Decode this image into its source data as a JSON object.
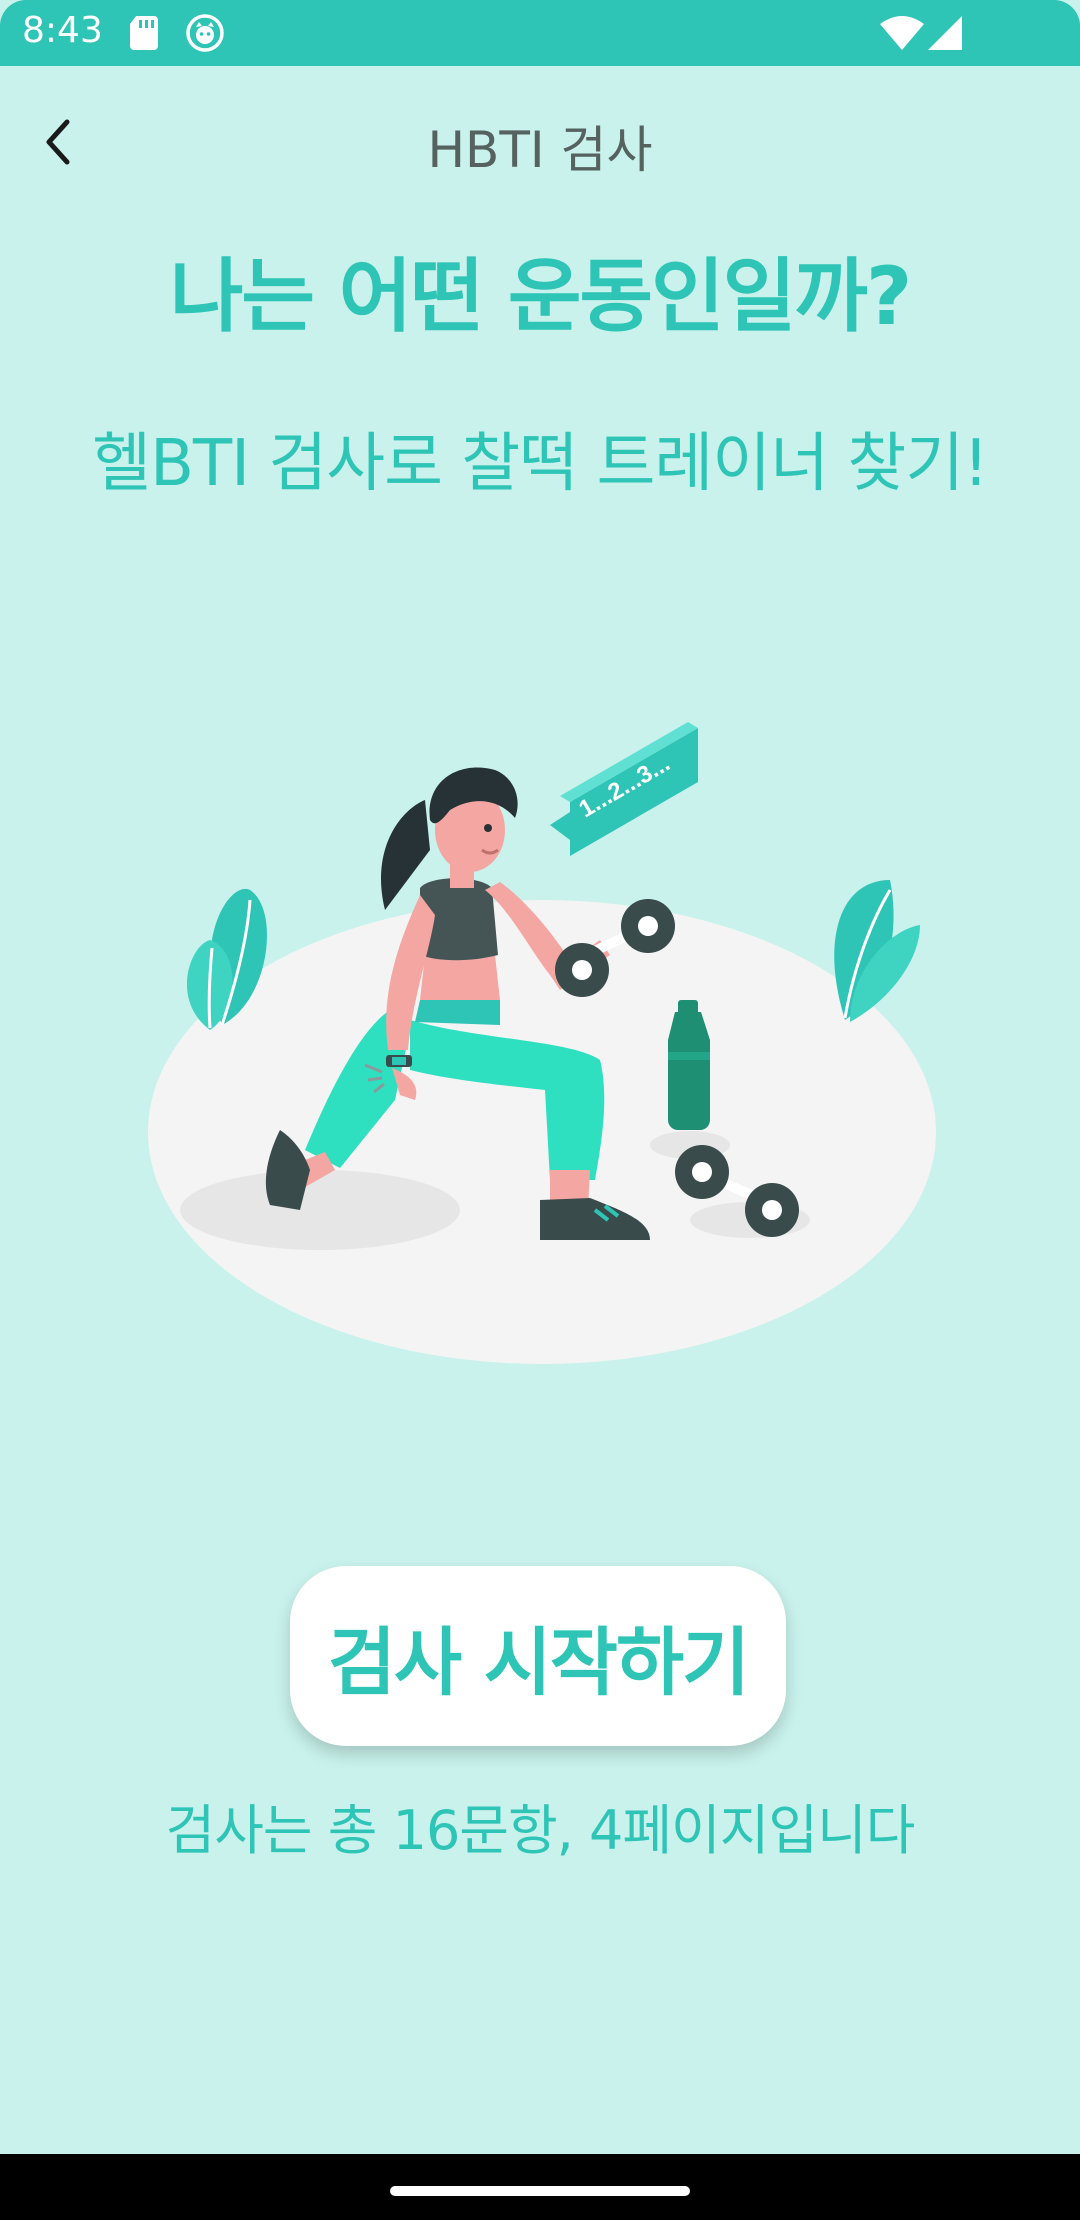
{
  "status_bar": {
    "time": "8:43",
    "icons": [
      "sd-card-icon",
      "notification-app-icon",
      "wifi-icon",
      "signal-icon"
    ]
  },
  "app_bar": {
    "title": "HBTI 검사",
    "back_icon": "chevron-left-icon"
  },
  "main": {
    "headline": "나는 어떤 운동인일까?",
    "subheadline": "헬BTI 검사로 찰떡 트레이너 찾기!",
    "illustration": {
      "subject": "woman-lifting-dumbbell",
      "speech_bubble": "1...2...3..."
    },
    "start_button_label": "검사 시작하기",
    "info_text": "검사는 총 16문항, 4페이지입니다"
  },
  "colors": {
    "background": "#c9f2ec",
    "accent": "#2ec4b6",
    "status_bar": "#2ec4b6",
    "title_gray": "#55625f"
  }
}
